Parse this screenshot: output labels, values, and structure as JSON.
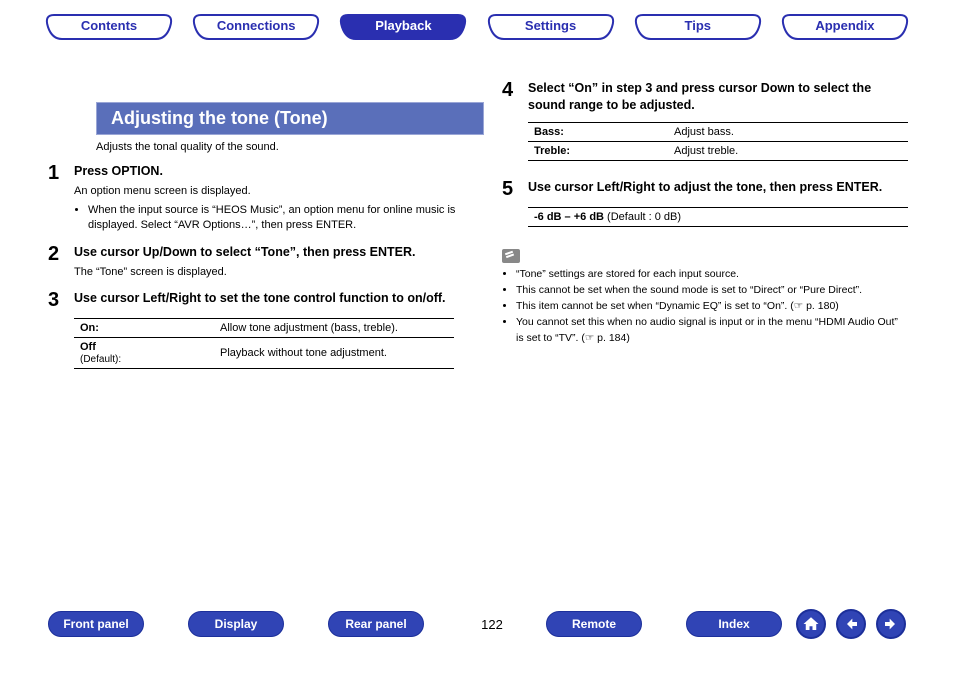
{
  "nav": {
    "tabs": [
      {
        "label": "Contents",
        "active": false
      },
      {
        "label": "Connections",
        "active": false
      },
      {
        "label": "Playback",
        "active": true
      },
      {
        "label": "Settings",
        "active": false
      },
      {
        "label": "Tips",
        "active": false
      },
      {
        "label": "Appendix",
        "active": false
      }
    ]
  },
  "section": {
    "title": "Adjusting the tone (Tone)",
    "intro": "Adjusts the tonal quality of the sound."
  },
  "steps": {
    "s1": {
      "num": "1",
      "title": "Press OPTION.",
      "desc": "An option menu screen is displayed.",
      "bullet": "When the input source is “HEOS Music”, an option menu for online music is displayed. Select “AVR Options…”, then press ENTER."
    },
    "s2": {
      "num": "2",
      "title": "Use cursor Up/Down to select “Tone”, then press ENTER.",
      "desc": "The “Tone” screen is displayed."
    },
    "s3": {
      "num": "3",
      "title": "Use cursor Left/Right to set the tone control function to on/off.",
      "table": {
        "rows": [
          {
            "key": "On:",
            "sub": "",
            "val": "Allow tone adjustment (bass, treble)."
          },
          {
            "key": "Off",
            "sub": "(Default):",
            "val": "Playback without tone adjustment."
          }
        ]
      }
    },
    "s4": {
      "num": "4",
      "title": "Select “On” in step 3 and press cursor Down to select the sound range to be adjusted.",
      "table": {
        "rows": [
          {
            "key": "Bass:",
            "val": "Adjust bass."
          },
          {
            "key": "Treble:",
            "val": "Adjust treble."
          }
        ]
      }
    },
    "s5": {
      "num": "5",
      "title": "Use cursor Left/Right to adjust the tone, then press ENTER.",
      "range_bold": "-6 dB – +6 dB",
      "range_rest": " (Default : 0 dB)"
    }
  },
  "notes": {
    "items": [
      "“Tone” settings are stored for each input source.",
      "This cannot be set when the sound mode is set to “Direct” or “Pure Direct”.",
      "This item cannot be set when “Dynamic EQ” is set to “On”.  (☞ p. 180)",
      "You cannot set this when no audio signal is input or in the menu “HDMI Audio Out” is set to “TV”.  (☞ p. 184)"
    ]
  },
  "footer": {
    "buttons": {
      "front_panel": "Front panel",
      "display": "Display",
      "rear_panel": "Rear panel",
      "remote": "Remote",
      "index": "Index"
    },
    "page": "122"
  }
}
